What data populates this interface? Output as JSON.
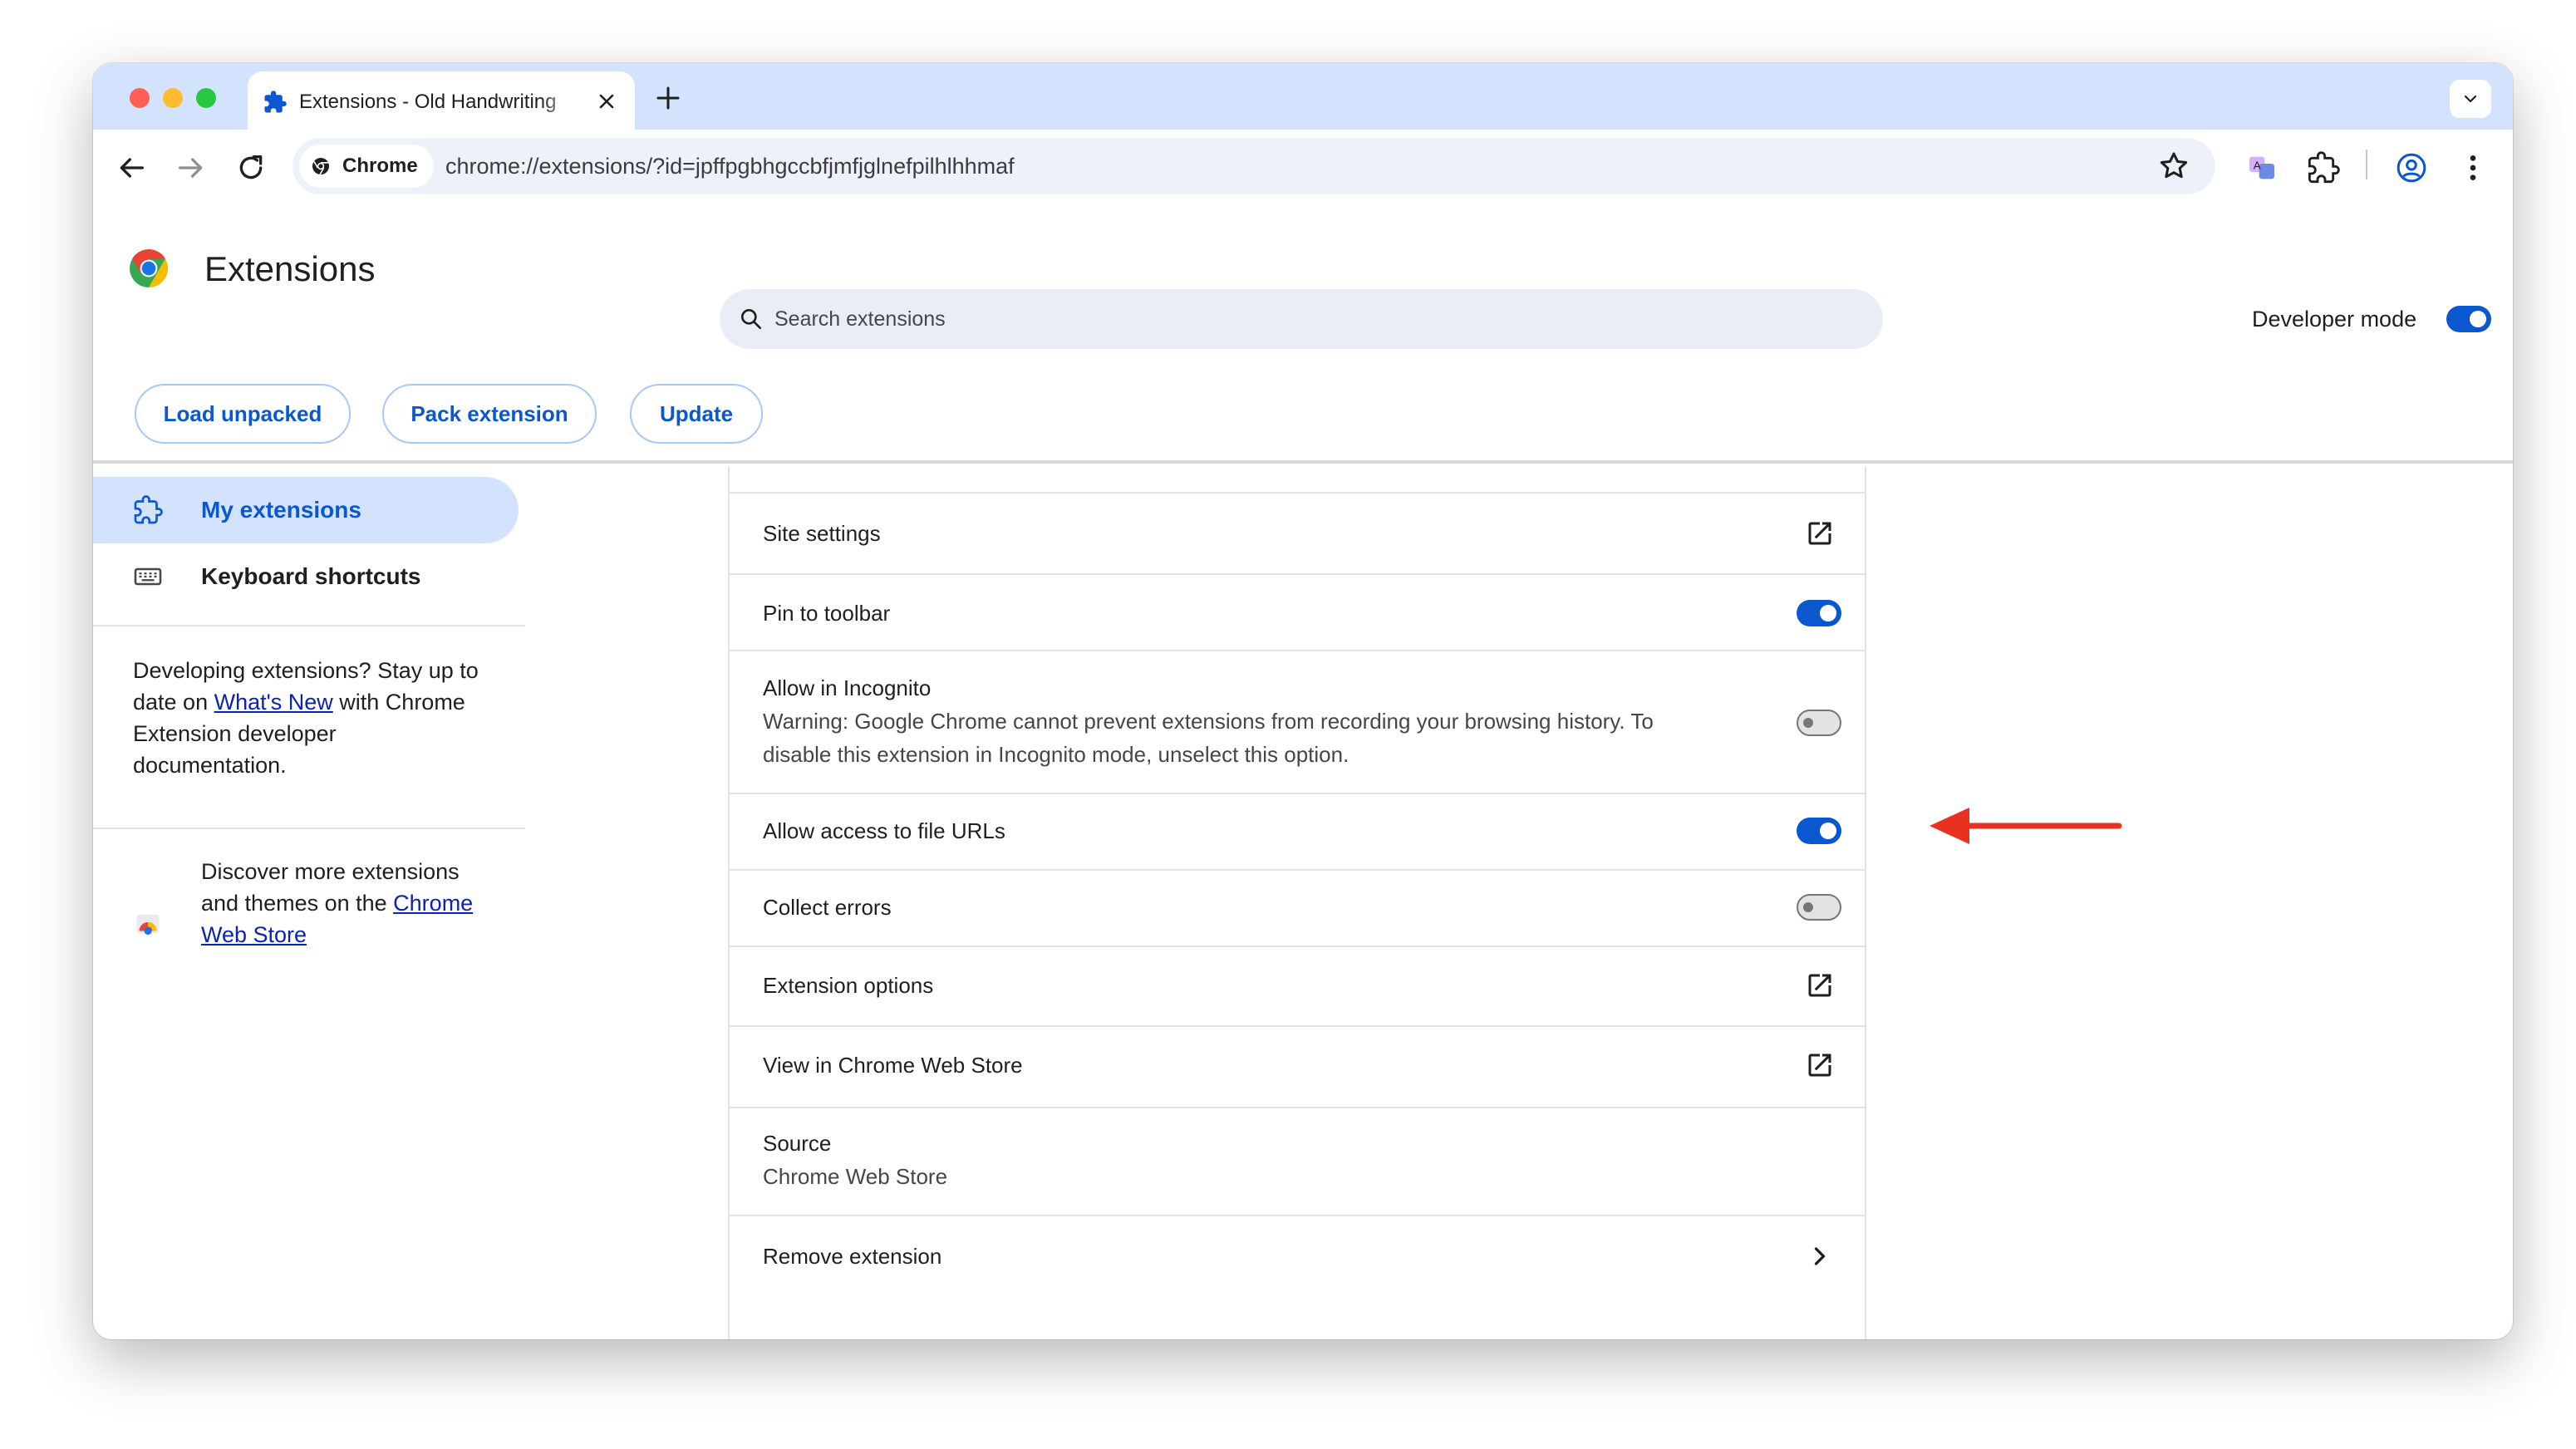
{
  "browser": {
    "tab_title": "Extensions - Old Handwriting",
    "omnibox_chip": "Chrome",
    "url": "chrome://extensions/?id=jpffpgbhgccbfjmfjglnefpilhlhhmaf"
  },
  "header": {
    "title": "Extensions",
    "search_placeholder": "Search extensions",
    "developer_mode_label": "Developer mode",
    "developer_mode_on": true
  },
  "actions": {
    "load_unpacked": "Load unpacked",
    "pack_extension": "Pack extension",
    "update": "Update"
  },
  "sidebar": {
    "items": [
      {
        "label": "My extensions",
        "active": true
      },
      {
        "label": "Keyboard shortcuts",
        "active": false
      }
    ],
    "dev_note": {
      "before": "Developing extensions? Stay up to date on ",
      "link": "What's New",
      "after": " with Chrome Extension developer documentation."
    },
    "store_note": {
      "before": "Discover more extensions and themes on the ",
      "link": "Chrome Web Store"
    }
  },
  "details": {
    "site_settings": "Site settings",
    "pin_to_toolbar": {
      "label": "Pin to toolbar",
      "on": true
    },
    "incognito": {
      "label": "Allow in Incognito",
      "warning": "Warning: Google Chrome cannot prevent extensions from recording your browsing history. To disable this extension in Incognito mode, unselect this option.",
      "on": false
    },
    "file_urls": {
      "label": "Allow access to file URLs",
      "on": true
    },
    "collect_errors": {
      "label": "Collect errors",
      "on": false
    },
    "extension_options": "Extension options",
    "view_in_store": "View in Chrome Web Store",
    "source": {
      "label": "Source",
      "value": "Chrome Web Store"
    },
    "remove": "Remove extension"
  },
  "colors": {
    "accent": "#0b57d0",
    "annotation_arrow": "#e8321f",
    "tab_strip": "#d3e3fd"
  },
  "icons": {
    "tab": "puzzle-icon",
    "site_settings": "open-in-new-icon",
    "extension_options": "open-in-new-icon",
    "view_in_store": "open-in-new-icon",
    "remove": "chevron-right-icon"
  }
}
